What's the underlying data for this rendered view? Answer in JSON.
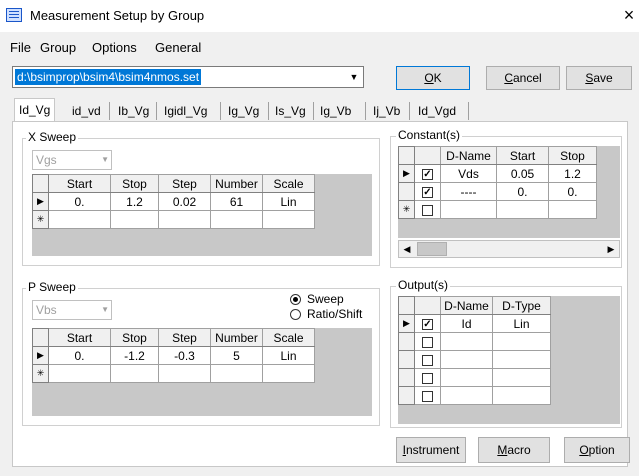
{
  "window": {
    "title": "Measurement Setup by Group",
    "close": "×"
  },
  "menu": [
    "File",
    "Group",
    "Options",
    "General"
  ],
  "file_path": "d:\\bsimprop\\bsim4\\bsim4nmos.set",
  "buttons": {
    "ok": "OK",
    "cancel": "Cancel",
    "save": "Save",
    "instrument": "Instrument",
    "macro": "Macro",
    "option": "Option"
  },
  "tabs": [
    "Id_Vg",
    "id_vd",
    "Ib_Vg",
    "Igidl_Vg",
    "Ig_Vg",
    "Is_Vg",
    "Ig_Vb",
    "Ij_Vb",
    "Id_Vgd"
  ],
  "active_tab": "Id_Vg",
  "x_sweep": {
    "label": "X Sweep",
    "variable": "Vgs",
    "headers": [
      "Start",
      "Stop",
      "Step",
      "Number",
      "Scale"
    ],
    "row": [
      "0.",
      "1.2",
      "0.02",
      "61",
      "Lin"
    ]
  },
  "p_sweep": {
    "label": "P Sweep",
    "variable": "Vbs",
    "mode_options": [
      "Sweep",
      "Ratio/Shift"
    ],
    "selected_mode": "Sweep",
    "headers": [
      "Start",
      "Stop",
      "Step",
      "Number",
      "Scale"
    ],
    "row": [
      "0.",
      "-1.2",
      "-0.3",
      "5",
      "Lin"
    ]
  },
  "constants": {
    "label": "Constant(s)",
    "headers": [
      "D-Name",
      "Start",
      "Stop"
    ],
    "rows": [
      {
        "checked": true,
        "name": "Vds",
        "start": "0.05",
        "stop": "1.2"
      },
      {
        "checked": true,
        "name": "----",
        "start": "0.",
        "stop": "0."
      }
    ]
  },
  "outputs": {
    "label": "Output(s)",
    "headers": [
      "D-Name",
      "D-Type"
    ],
    "rows": [
      {
        "checked": true,
        "name": "Id",
        "type": "Lin"
      }
    ]
  },
  "glyphs": {
    "row_pointer": "▶",
    "new_row": "✳",
    "check": "✓",
    "left": "◀",
    "right": "▶",
    "down": "▼"
  }
}
